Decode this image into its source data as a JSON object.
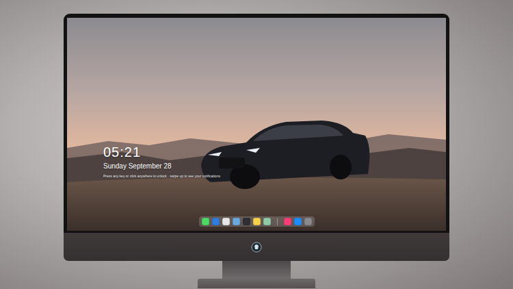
{
  "lock_screen": {
    "time": "05:21",
    "date": "Sunday September 28",
    "hint": "Press any key or click anywhere to unlock · swipe up to see your notifications"
  }
}
